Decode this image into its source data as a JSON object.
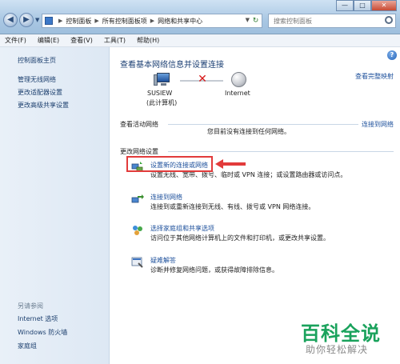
{
  "address": {
    "crumbs": [
      "控制面板",
      "所有控制面板项",
      "网络和共享中心"
    ],
    "search_placeholder": "搜索控制面板"
  },
  "window_buttons": {
    "minimize": "—",
    "maximize": "□",
    "close": "✕"
  },
  "menu": [
    "文件(F)",
    "编辑(E)",
    "查看(V)",
    "工具(T)",
    "帮助(H)"
  ],
  "sidebar": {
    "links": [
      "控制面板主页",
      "管理无线网络",
      "更改适配器设置",
      "更改高级共享设置"
    ],
    "see_also_label": "另请参阅",
    "see_also": [
      "Internet 选项",
      "Windows 防火墙",
      "家庭组"
    ]
  },
  "main": {
    "title": "查看基本网络信息并设置连接",
    "full_map": "查看完整映射",
    "computer_name": "SUSIEW",
    "computer_sub": "(此计算机)",
    "internet_label": "Internet",
    "active_header": "查看活动网络",
    "connect_link": "连接到网络",
    "no_connection": "您目前没有连接到任何网络。",
    "change_header": "更改网络设置",
    "tasks": [
      {
        "title": "设置新的连接或网络",
        "desc": "设置无线、宽带、拨号、临时或 VPN 连接；或设置路由器或访问点。"
      },
      {
        "title": "连接到网络",
        "desc": "连接到或重新连接到无线、有线、拨号或 VPN 网络连接。"
      },
      {
        "title": "选择家庭组和共享选项",
        "desc": "访问位于其他网络计算机上的文件和打印机，或更改共享设置。"
      },
      {
        "title": "疑难解答",
        "desc": "诊断并修复网络问题，或获得故障排除信息。"
      }
    ]
  },
  "watermark": {
    "logo": "百科全说",
    "sub": "助你轻松解决"
  },
  "colors": {
    "link": "#1c4f9b",
    "highlight": "#e23b3b",
    "watermark": "#1aa25c"
  }
}
